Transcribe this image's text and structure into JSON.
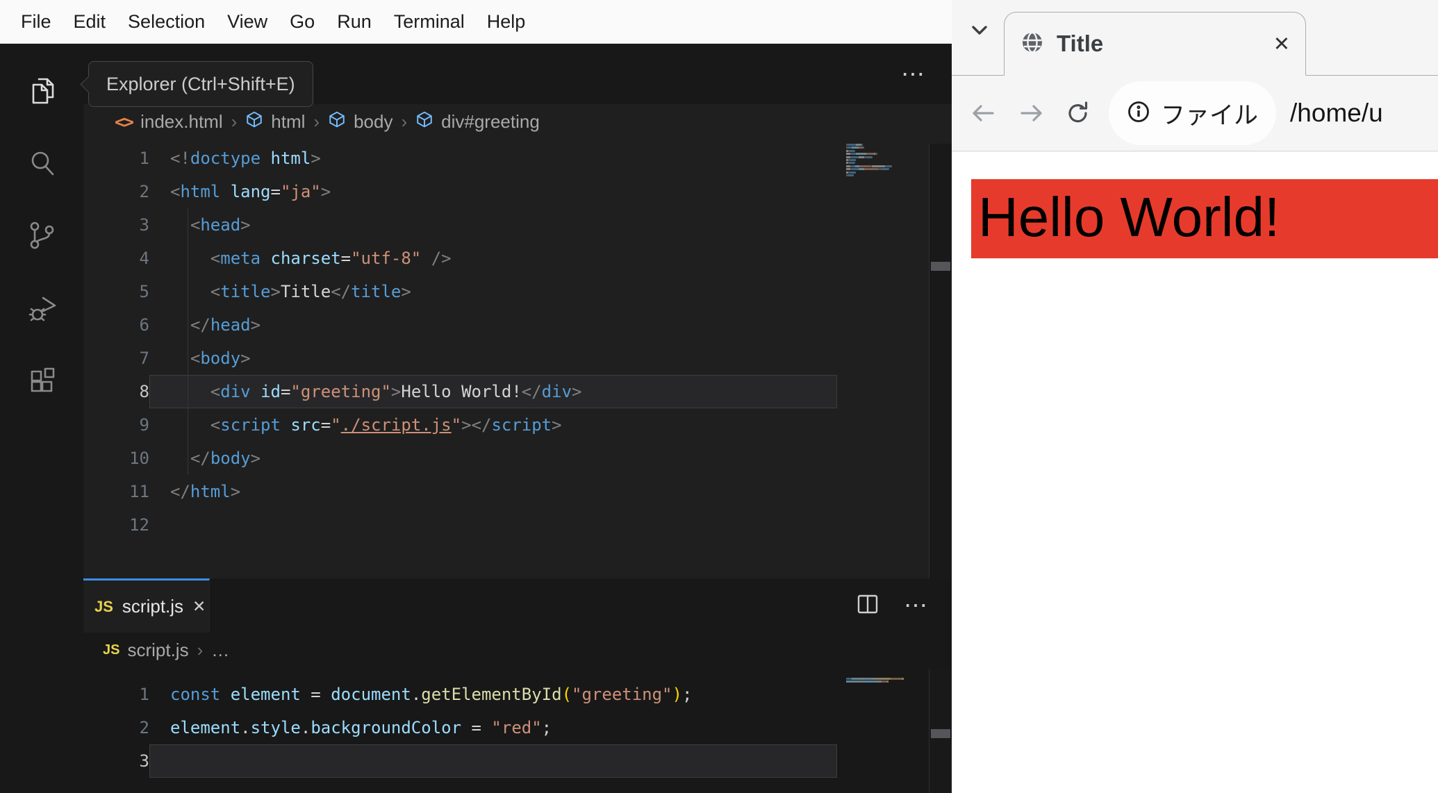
{
  "vscode": {
    "menubar": {
      "items": [
        "File",
        "Edit",
        "Selection",
        "View",
        "Go",
        "Run",
        "Terminal",
        "Help"
      ]
    },
    "activity_bar": {
      "items": [
        {
          "name": "explorer",
          "active": true
        },
        {
          "name": "search",
          "active": false
        },
        {
          "name": "source-control",
          "active": false
        },
        {
          "name": "run-and-debug",
          "active": false
        },
        {
          "name": "extensions",
          "active": false
        }
      ]
    },
    "tooltip": {
      "text": "Explorer (Ctrl+Shift+E)"
    },
    "editor_actions": {
      "more_glyph": "⋯"
    },
    "breadcrumbs_html": {
      "separator": "›",
      "items": [
        {
          "icon": "html-file",
          "label": "index.html"
        },
        {
          "icon": "symbol-cube",
          "label": "html"
        },
        {
          "icon": "symbol-cube",
          "label": "body"
        },
        {
          "icon": "symbol-cube",
          "label": "div#greeting"
        }
      ]
    },
    "html_editor": {
      "active_line": 8,
      "lines": [
        [
          {
            "c": "p",
            "t": "<!"
          },
          {
            "c": "t",
            "t": "doctype"
          },
          {
            "c": "x",
            "t": " "
          },
          {
            "c": "a",
            "t": "html"
          },
          {
            "c": "p",
            "t": ">"
          }
        ],
        [
          {
            "c": "p",
            "t": "<"
          },
          {
            "c": "t",
            "t": "html"
          },
          {
            "c": "x",
            "t": " "
          },
          {
            "c": "a",
            "t": "lang"
          },
          {
            "c": "o",
            "t": "="
          },
          {
            "c": "s",
            "t": "\"ja\""
          },
          {
            "c": "p",
            "t": ">"
          }
        ],
        [
          {
            "c": "x",
            "t": "  "
          },
          {
            "c": "p",
            "t": "<"
          },
          {
            "c": "t",
            "t": "head"
          },
          {
            "c": "p",
            "t": ">"
          }
        ],
        [
          {
            "c": "x",
            "t": "    "
          },
          {
            "c": "p",
            "t": "<"
          },
          {
            "c": "t",
            "t": "meta"
          },
          {
            "c": "x",
            "t": " "
          },
          {
            "c": "a",
            "t": "charset"
          },
          {
            "c": "o",
            "t": "="
          },
          {
            "c": "s",
            "t": "\"utf-8\""
          },
          {
            "c": "x",
            "t": " "
          },
          {
            "c": "p",
            "t": "/>"
          }
        ],
        [
          {
            "c": "x",
            "t": "    "
          },
          {
            "c": "p",
            "t": "<"
          },
          {
            "c": "t",
            "t": "title"
          },
          {
            "c": "p",
            "t": ">"
          },
          {
            "c": "x",
            "t": "Title"
          },
          {
            "c": "p",
            "t": "</"
          },
          {
            "c": "t",
            "t": "title"
          },
          {
            "c": "p",
            "t": ">"
          }
        ],
        [
          {
            "c": "x",
            "t": "  "
          },
          {
            "c": "p",
            "t": "</"
          },
          {
            "c": "t",
            "t": "head"
          },
          {
            "c": "p",
            "t": ">"
          }
        ],
        [
          {
            "c": "x",
            "t": "  "
          },
          {
            "c": "p",
            "t": "<"
          },
          {
            "c": "t",
            "t": "body"
          },
          {
            "c": "p",
            "t": ">"
          }
        ],
        [
          {
            "c": "x",
            "t": "    "
          },
          {
            "c": "p",
            "t": "<"
          },
          {
            "c": "t",
            "t": "div"
          },
          {
            "c": "x",
            "t": " "
          },
          {
            "c": "a",
            "t": "id"
          },
          {
            "c": "o",
            "t": "="
          },
          {
            "c": "s",
            "t": "\"greeting\""
          },
          {
            "c": "p",
            "t": ">"
          },
          {
            "c": "x",
            "t": "Hello World!"
          },
          {
            "c": "p",
            "t": "</"
          },
          {
            "c": "t",
            "t": "div"
          },
          {
            "c": "p",
            "t": ">"
          }
        ],
        [
          {
            "c": "x",
            "t": "    "
          },
          {
            "c": "p",
            "t": "<"
          },
          {
            "c": "t",
            "t": "script"
          },
          {
            "c": "x",
            "t": " "
          },
          {
            "c": "a",
            "t": "src"
          },
          {
            "c": "o",
            "t": "="
          },
          {
            "c": "s",
            "t": "\""
          },
          {
            "c": "l",
            "t": "./script.js"
          },
          {
            "c": "s",
            "t": "\""
          },
          {
            "c": "p",
            "t": ">"
          },
          {
            "c": "p",
            "t": "</"
          },
          {
            "c": "t",
            "t": "script"
          },
          {
            "c": "p",
            "t": ">"
          }
        ],
        [
          {
            "c": "x",
            "t": "  "
          },
          {
            "c": "p",
            "t": "</"
          },
          {
            "c": "t",
            "t": "body"
          },
          {
            "c": "p",
            "t": ">"
          }
        ],
        [
          {
            "c": "p",
            "t": "</"
          },
          {
            "c": "t",
            "t": "html"
          },
          {
            "c": "p",
            "t": ">"
          }
        ],
        []
      ]
    },
    "js_tab": {
      "icon": "JS",
      "label": "script.js",
      "close_glyph": "✕"
    },
    "breadcrumbs_js": {
      "icon": "JS",
      "file": "script.js",
      "separator": "›",
      "ellipsis": "…"
    },
    "js_editor": {
      "active_line": 3,
      "lines": [
        [
          {
            "c": "k",
            "t": "const"
          },
          {
            "c": "x",
            "t": " "
          },
          {
            "c": "v",
            "t": "element"
          },
          {
            "c": "o",
            "t": " = "
          },
          {
            "c": "v",
            "t": "document"
          },
          {
            "c": "o",
            "t": "."
          },
          {
            "c": "f",
            "t": "getElementById"
          },
          {
            "c": "b",
            "t": "("
          },
          {
            "c": "s",
            "t": "\"greeting\""
          },
          {
            "c": "b",
            "t": ")"
          },
          {
            "c": "o",
            "t": ";"
          }
        ],
        [
          {
            "c": "v",
            "t": "element"
          },
          {
            "c": "o",
            "t": "."
          },
          {
            "c": "v",
            "t": "style"
          },
          {
            "c": "o",
            "t": "."
          },
          {
            "c": "v",
            "t": "backgroundColor"
          },
          {
            "c": "o",
            "t": " = "
          },
          {
            "c": "s",
            "t": "\"red\""
          },
          {
            "c": "o",
            "t": ";"
          }
        ],
        []
      ]
    },
    "colors": {
      "active_tab_accent": "#3b8eea"
    }
  },
  "browser": {
    "tab": {
      "title": "Title",
      "close_glyph": "✕"
    },
    "toolbar": {
      "chip_label": "ファイル",
      "url": "/home/u"
    },
    "page": {
      "heading": "Hello World!",
      "heading_bg": "#e63b2c",
      "heading_color": "#000000"
    }
  }
}
